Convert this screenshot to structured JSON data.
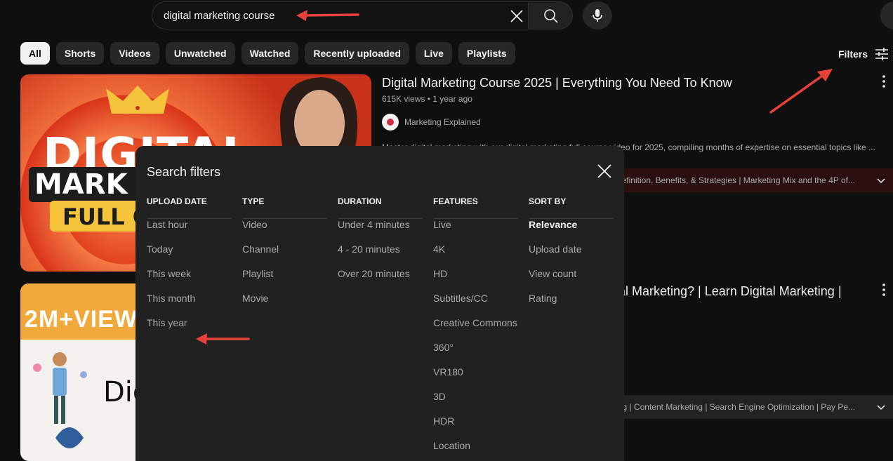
{
  "search": {
    "query": "digital marketing course"
  },
  "chips": [
    "All",
    "Shorts",
    "Videos",
    "Unwatched",
    "Watched",
    "Recently uploaded",
    "Live",
    "Playlists"
  ],
  "filters_label": "Filters",
  "results": [
    {
      "title": "Digital Marketing Course 2025 | Everything You Need To Know",
      "views": "615K views",
      "age": "1 year ago",
      "channel": "Marketing Explained",
      "description": "Master digital marketing with our digital marketing full course video for 2025, compiling months of expertise on essential topics like ...",
      "chapters": "efinition, Benefits, & Strategies | Marketing Mix and the 4P of...",
      "thumb_lines": [
        "DIGITAL",
        "MARK",
        "FULL CO"
      ]
    },
    {
      "title": "ital Marketing? | Learn Digital Marketing |",
      "chapters": "keting | Content Marketing | Search Engine Optimization | Pay Pe...",
      "thumb_lines": [
        "2M+VIEW",
        "Dig"
      ]
    }
  ],
  "dialog": {
    "title": "Search filters",
    "columns": [
      {
        "heading": "UPLOAD DATE",
        "options": [
          "Last hour",
          "Today",
          "This week",
          "This month",
          "This year"
        ]
      },
      {
        "heading": "TYPE",
        "options": [
          "Video",
          "Channel",
          "Playlist",
          "Movie"
        ]
      },
      {
        "heading": "DURATION",
        "options": [
          "Under 4 minutes",
          "4 - 20 minutes",
          "Over 20 minutes"
        ]
      },
      {
        "heading": "FEATURES",
        "options": [
          "Live",
          "4K",
          "HD",
          "Subtitles/CC",
          "Creative Commons",
          "360°",
          "VR180",
          "3D",
          "HDR",
          "Location"
        ]
      },
      {
        "heading": "SORT BY",
        "options": [
          "Relevance",
          "Upload date",
          "View count",
          "Rating"
        ],
        "selected": "Relevance"
      }
    ]
  },
  "colors": {
    "background": "#0f0f0f",
    "dialog": "#212121",
    "annotation_arrow": "#e8413a"
  }
}
